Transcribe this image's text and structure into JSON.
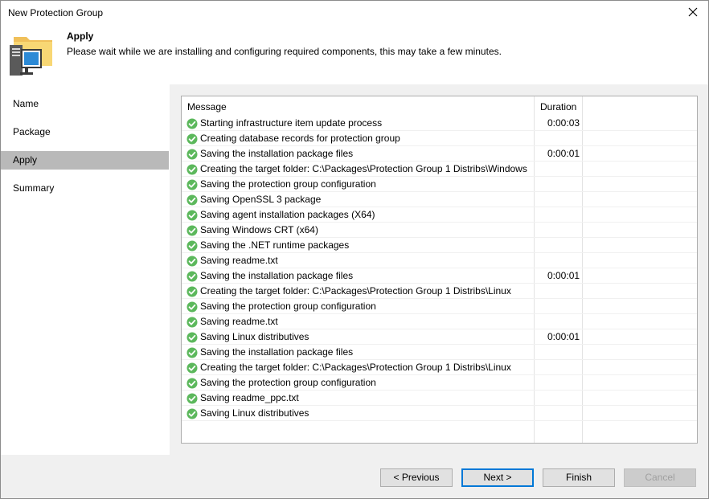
{
  "window": {
    "title": "New Protection Group"
  },
  "header": {
    "title": "Apply",
    "description": "Please wait while we are installing and configuring required components, this may take a few minutes."
  },
  "sidebar": {
    "items": [
      {
        "label": "Name"
      },
      {
        "label": "Package"
      },
      {
        "label": "Apply"
      },
      {
        "label": "Summary"
      }
    ],
    "active": "Apply"
  },
  "log": {
    "columns": {
      "message": "Message",
      "duration": "Duration"
    },
    "rows": [
      {
        "message": "Starting infrastructure item update process",
        "duration": "0:00:03"
      },
      {
        "message": "Creating database records for protection group",
        "duration": ""
      },
      {
        "message": "Saving the installation package files",
        "duration": "0:00:01"
      },
      {
        "message": "Creating the target folder: C:\\Packages\\Protection Group 1 Distribs\\Windows",
        "duration": ""
      },
      {
        "message": "Saving the protection group configuration",
        "duration": ""
      },
      {
        "message": "Saving OpenSSL 3 package",
        "duration": ""
      },
      {
        "message": "Saving agent installation packages (X64)",
        "duration": ""
      },
      {
        "message": "Saving Windows CRT (x64)",
        "duration": ""
      },
      {
        "message": "Saving the .NET runtime packages",
        "duration": ""
      },
      {
        "message": "Saving readme.txt",
        "duration": ""
      },
      {
        "message": "Saving the installation package files",
        "duration": "0:00:01"
      },
      {
        "message": "Creating the target folder: C:\\Packages\\Protection Group 1 Distribs\\Linux",
        "duration": ""
      },
      {
        "message": "Saving the protection group configuration",
        "duration": ""
      },
      {
        "message": "Saving readme.txt",
        "duration": ""
      },
      {
        "message": "Saving Linux distributives",
        "duration": "0:00:01"
      },
      {
        "message": "Saving the installation package files",
        "duration": ""
      },
      {
        "message": "Creating the target folder: C:\\Packages\\Protection Group 1 Distribs\\Linux",
        "duration": ""
      },
      {
        "message": "Saving the protection group configuration",
        "duration": ""
      },
      {
        "message": "Saving readme_ppc.txt",
        "duration": ""
      },
      {
        "message": "Saving Linux distributives",
        "duration": ""
      }
    ],
    "status_icon": "success-check-icon",
    "status_color": "#5cb85c"
  },
  "footer": {
    "previous_label": "< Previous",
    "next_label": "Next >",
    "finish_label": "Finish",
    "cancel_label": "Cancel"
  },
  "colors": {
    "accent": "#0078d7",
    "selected_nav": "#b9b9b9",
    "panel": "#f0f0f0"
  }
}
